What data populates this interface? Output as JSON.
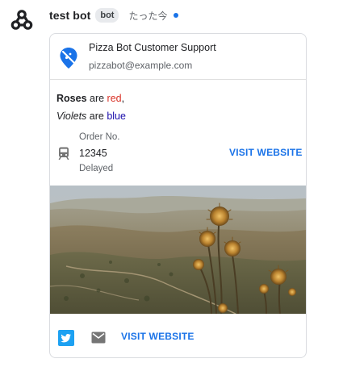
{
  "message": {
    "sender": "test bot",
    "badge": "bot",
    "timestamp": "たった今",
    "unread_color": "#1a73e8"
  },
  "card": {
    "header": {
      "title": "Pizza Bot Customer Support",
      "subtitle": "pizzabot@example.com",
      "logo_icon": "map-pin-icon"
    },
    "text_lines": [
      {
        "parts": [
          "Roses",
          " are ",
          "red",
          ","
        ]
      },
      {
        "parts": [
          "Violets",
          " are ",
          "blue"
        ]
      }
    ],
    "key_value": {
      "icon": "train-icon",
      "top_label": "Order No.",
      "content": "12345",
      "bottom_label": "Delayed",
      "button": "VISIT WEBSITE"
    },
    "image": {
      "alt_icon": "thistle-landscape-photo"
    },
    "footer": {
      "icons": [
        "twitter-icon",
        "mail-icon"
      ],
      "button": "VISIT WEBSITE"
    }
  },
  "colors": {
    "accent": "#1a73e8",
    "red_text": "#d93025",
    "blue_text": "#1a0dab",
    "twitter": "#1da1f2"
  }
}
